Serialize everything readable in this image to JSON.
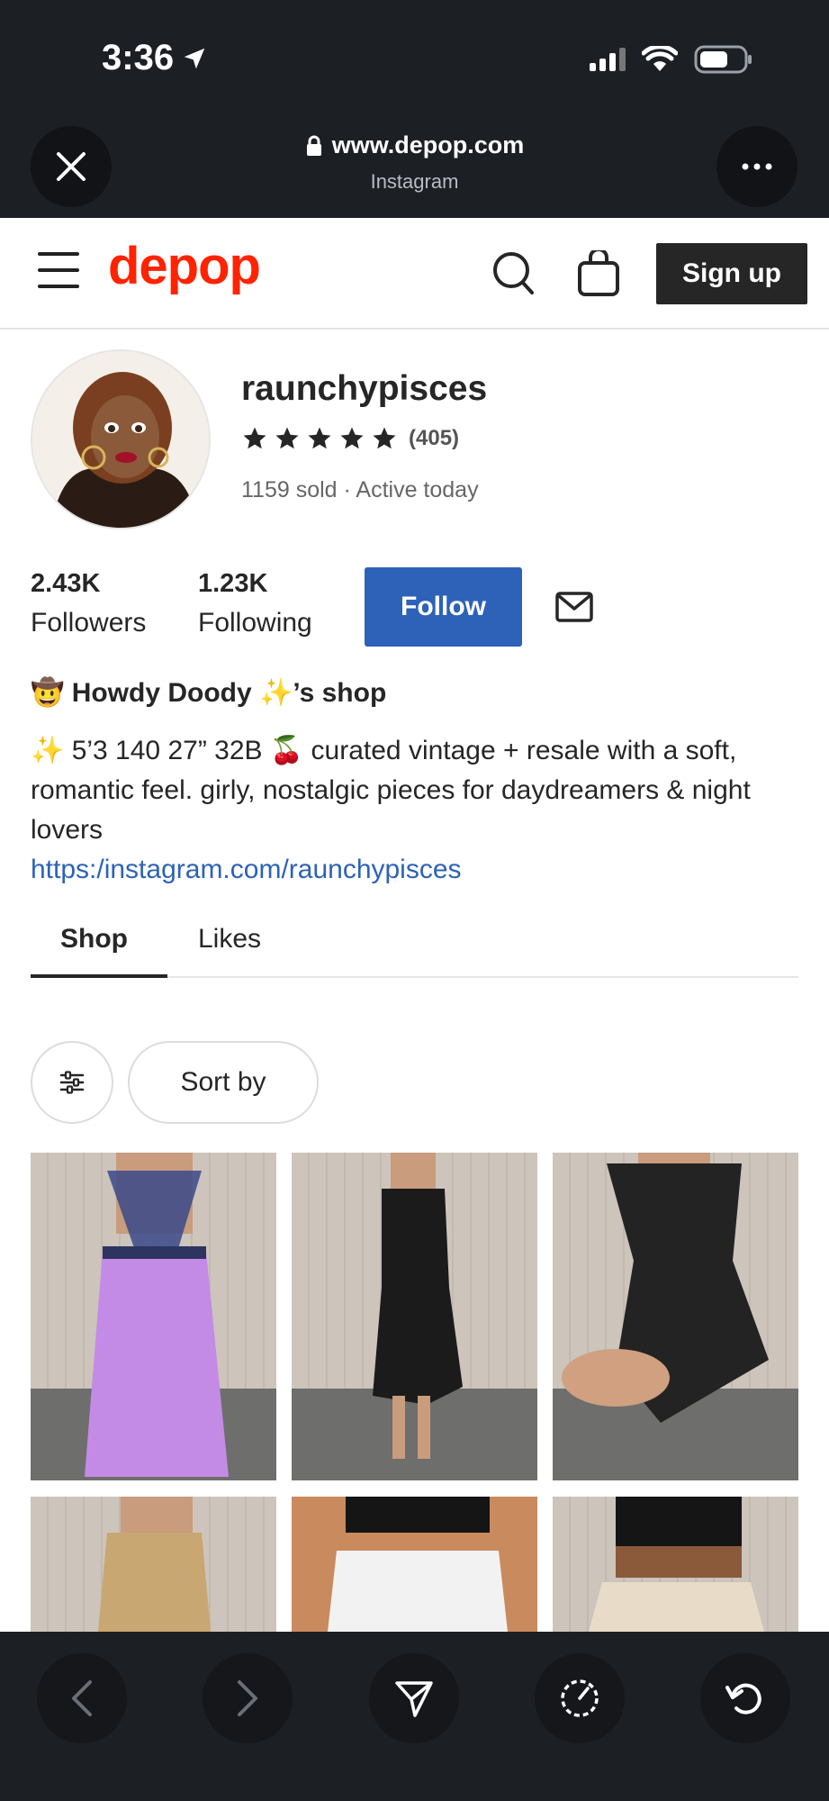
{
  "status_bar": {
    "time": "3:36"
  },
  "browser": {
    "url": "www.depop.com",
    "source": "Instagram"
  },
  "header": {
    "logo": "depop",
    "signup_label": "Sign up"
  },
  "profile": {
    "username": "raunchypisces",
    "rating_stars": 5,
    "rating_count": "(405)",
    "sold_line": "1159 sold · Active today",
    "followers_count": "2.43K",
    "followers_label": "Followers",
    "following_count": "1.23K",
    "following_label": "Following",
    "follow_label": "Follow",
    "shop_title": "🤠 Howdy Doody ✨’s shop",
    "bio": "✨ 5’3 140 27” 32B 🍒 curated vintage + resale with a soft, romantic feel. girly, nostalgic pieces for daydreamers & night lovers",
    "link": "https:/instagram.com/raunchypisces"
  },
  "tabs": [
    {
      "label": "Shop",
      "active": true
    },
    {
      "label": "Likes",
      "active": false
    }
  ],
  "controls": {
    "sort_label": "Sort by"
  },
  "listings": [
    {
      "garment": "lilac slip dress with beaded straps",
      "color": "#c48be6"
    },
    {
      "garment": "black polka dot midi dress",
      "color": "#1b1b1b"
    },
    {
      "garment": "black ruffle mini dress",
      "color": "#232323"
    },
    {
      "garment": "gold satin slip dress",
      "color": "#c9a772"
    },
    {
      "garment": "white denim skirt with black top",
      "color": "#f2f2f2"
    },
    {
      "garment": "floral skirt with black top",
      "color": "#e8dcc8"
    }
  ],
  "colors": {
    "chrome": "#1c1f24",
    "brand": "#ff2300",
    "follow": "#2d62b8",
    "signup": "#262626"
  }
}
